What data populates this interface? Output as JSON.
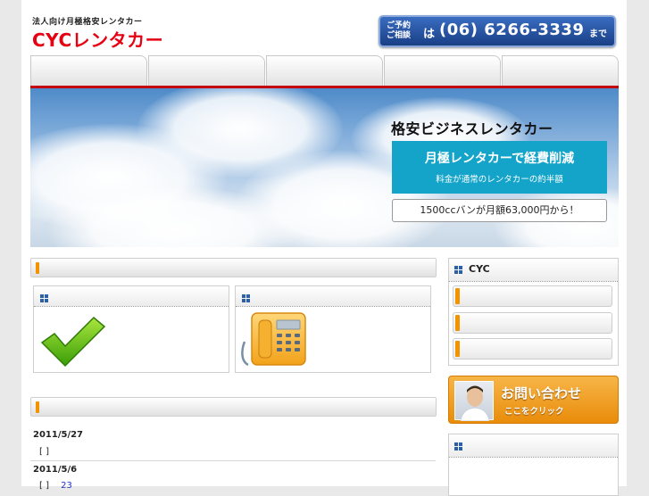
{
  "header": {
    "tagline": "法人向け月極格安レンタカー",
    "logo": "CYCレンタカー",
    "tel_label_1": "ご予約",
    "tel_label_2": "ご相談",
    "tel_ha": "は",
    "tel_number": "(06) 6266-3339",
    "tel_made": "まで"
  },
  "nav": {
    "tabs": [
      "",
      "",
      "",
      "",
      ""
    ]
  },
  "hero": {
    "title": "格安ビジネスレンタカー",
    "box_line1": "月極レンタカーで経費削減",
    "box_line2": "料金が通常のレンタカーの約半額",
    "price": "1500ccバンが月額63,000円から！"
  },
  "main": {
    "section_title": "",
    "box_left_title": "",
    "box_right_title": "",
    "news_section_title": "",
    "news": [
      {
        "date": "2011/5/27",
        "text": "[ ]",
        "link": ""
      },
      {
        "date": "2011/5/6",
        "text": "[ ]",
        "link": "23"
      }
    ]
  },
  "sidebar": {
    "cyc_title": "CYC",
    "items": [
      "",
      "",
      ""
    ],
    "contact_title": "お問い合わせ",
    "contact_sub": "ここをクリック",
    "second_title": ""
  },
  "colors": {
    "brand_red": "#e60012",
    "accent_orange": "#f29300",
    "hero_box_blue": "#14a4c9",
    "tel_blue": "#1a3f86",
    "link_blue": "#2233cc"
  },
  "icons": [
    "checkmark-icon",
    "telephone-icon",
    "grid-square-icon"
  ]
}
